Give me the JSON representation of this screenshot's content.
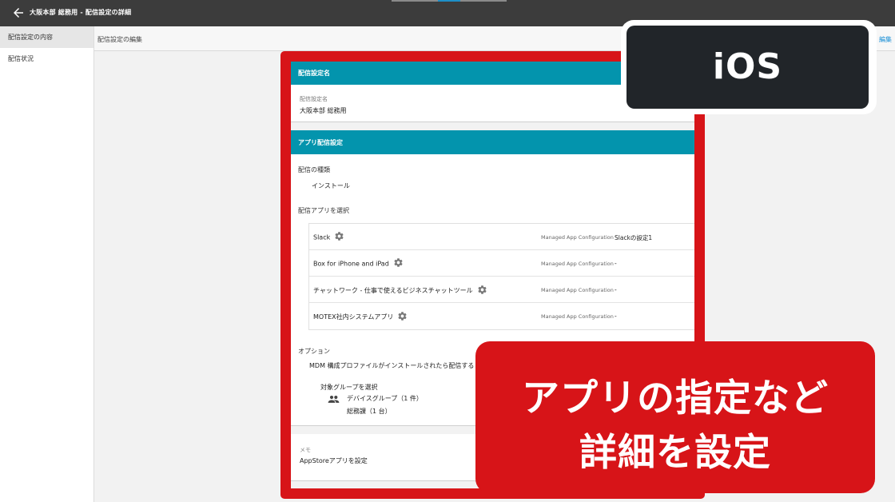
{
  "header": {
    "title": "大阪本部 総務用 - 配信設定の詳細",
    "back_icon": "arrow-left-icon"
  },
  "sidebar": {
    "items": [
      {
        "label": "配信設定の内容",
        "active": true
      },
      {
        "label": "配信状況",
        "active": false
      }
    ]
  },
  "subbar": {
    "label": "配信設定の編集",
    "edit_link": "編集"
  },
  "section_name": {
    "header": "配信設定名",
    "field_label": "配信設定名",
    "field_value": "大阪本部 総務用"
  },
  "section_app": {
    "header": "アプリ配信設定",
    "type_label": "配信の種類",
    "type_value": "インストール",
    "select_label": "配信アプリを選択",
    "apps": [
      {
        "name": "Slack",
        "conf_label": "Managed App Configuration",
        "conf_value": "Slackの設定1"
      },
      {
        "name": "Box for iPhone and iPad",
        "conf_label": "Managed App Configuration",
        "conf_value": "-"
      },
      {
        "name": "チャットワーク - 仕事で使えるビジネスチャットツール",
        "conf_label": "Managed App Configuration",
        "conf_value": "-"
      },
      {
        "name": "MOTEX社内システムアプリ",
        "conf_label": "Managed App Configuration",
        "conf_value": "-"
      }
    ],
    "option_label": "オプション",
    "option_value": "MDM 構成プロファイルがインストールされたら配信する",
    "target_label": "対象グループを選択",
    "group_name": "デバイスグループ（1 件）",
    "group_item": "総務課（1 台）"
  },
  "section_memo": {
    "label": "メモ",
    "value": "AppStoreアプリを設定"
  },
  "overlay": {
    "badge": "iOS",
    "callout_line1": "アプリの指定など",
    "callout_line2": "詳細を設定"
  },
  "colors": {
    "header_bg": "#3c3c3c",
    "card_head_bg": "#0394ad",
    "frame_red": "#d71418",
    "badge_bg": "#212529"
  }
}
